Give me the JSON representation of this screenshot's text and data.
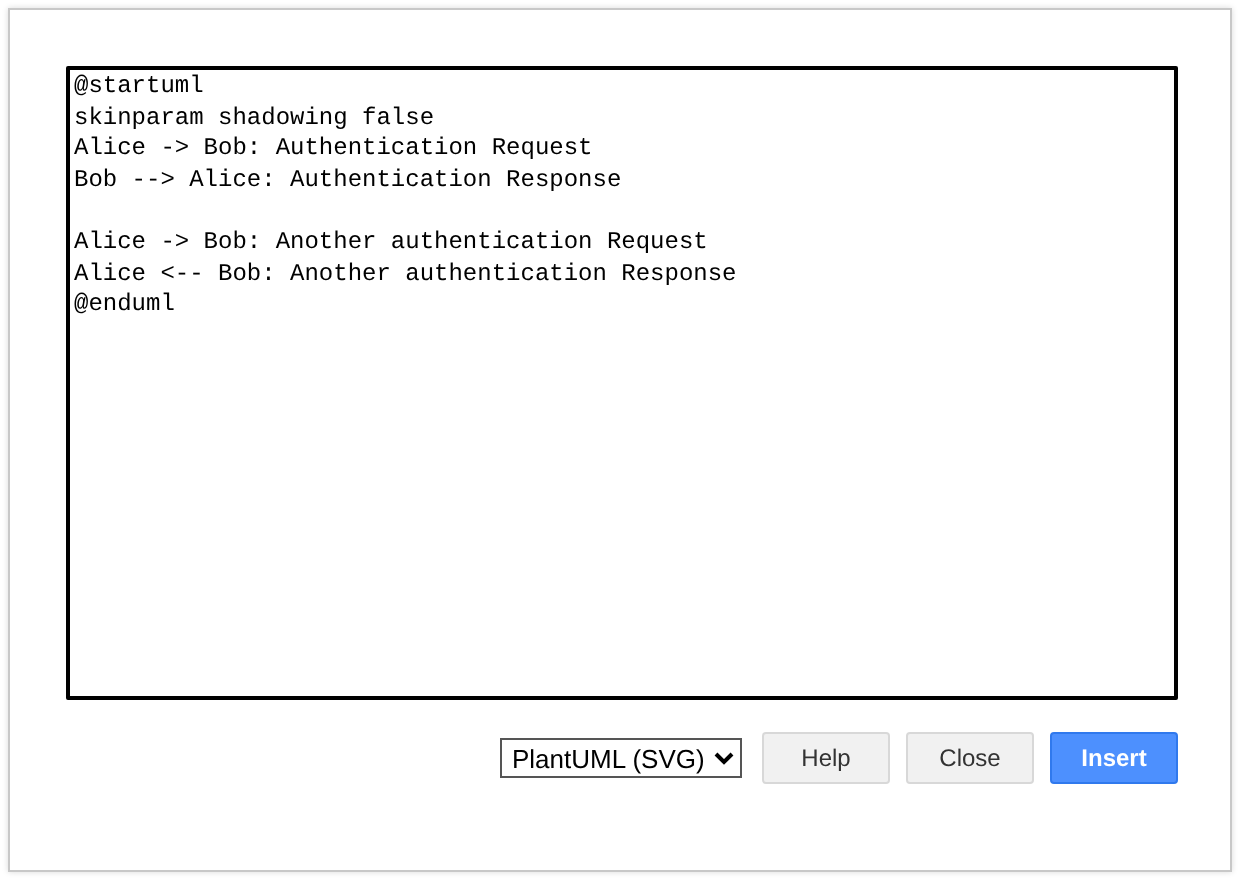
{
  "editor": {
    "value": "@startuml\nskinparam shadowing false\nAlice -> Bob: Authentication Request\nBob --> Alice: Authentication Response\n\nAlice -> Bob: Another authentication Request\nAlice <-- Bob: Another authentication Response\n@enduml"
  },
  "format_select": {
    "value": "PlantUML (SVG)"
  },
  "buttons": [
    {
      "label": "Help",
      "kind": "default"
    },
    {
      "label": "Close",
      "kind": "default"
    },
    {
      "label": "Insert",
      "kind": "primary"
    }
  ]
}
